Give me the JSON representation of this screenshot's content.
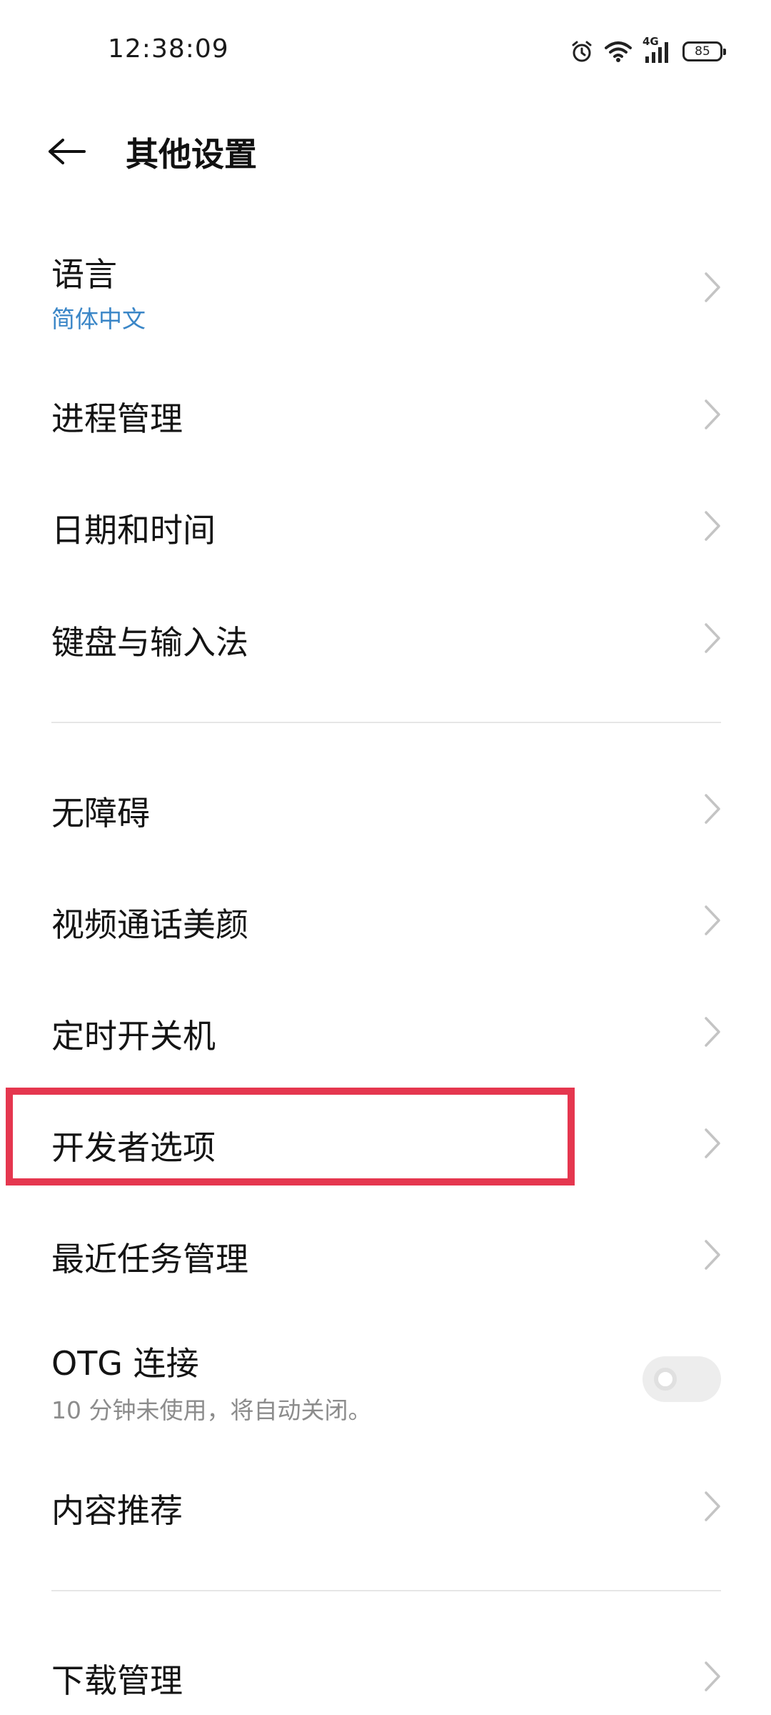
{
  "status_bar": {
    "time": "12:38:09",
    "network_label": "4G",
    "battery_level": "85"
  },
  "header": {
    "title": "其他设置"
  },
  "items": [
    {
      "label": "语言",
      "subtitle": "简体中文"
    },
    {
      "label": "进程管理"
    },
    {
      "label": "日期和时间"
    },
    {
      "label": "键盘与输入法"
    },
    {
      "label": "无障碍"
    },
    {
      "label": "视频通话美颜"
    },
    {
      "label": "定时开关机"
    },
    {
      "label": "开发者选项"
    },
    {
      "label": "最近任务管理"
    },
    {
      "label": "OTG 连接",
      "subtitle": "10 分钟未使用，将自动关闭。",
      "toggle_on": false
    },
    {
      "label": "内容推荐"
    },
    {
      "label": "下载管理"
    }
  ],
  "colors": {
    "highlight": "#e5374f",
    "subtitle_accent": "#3a86c7"
  }
}
